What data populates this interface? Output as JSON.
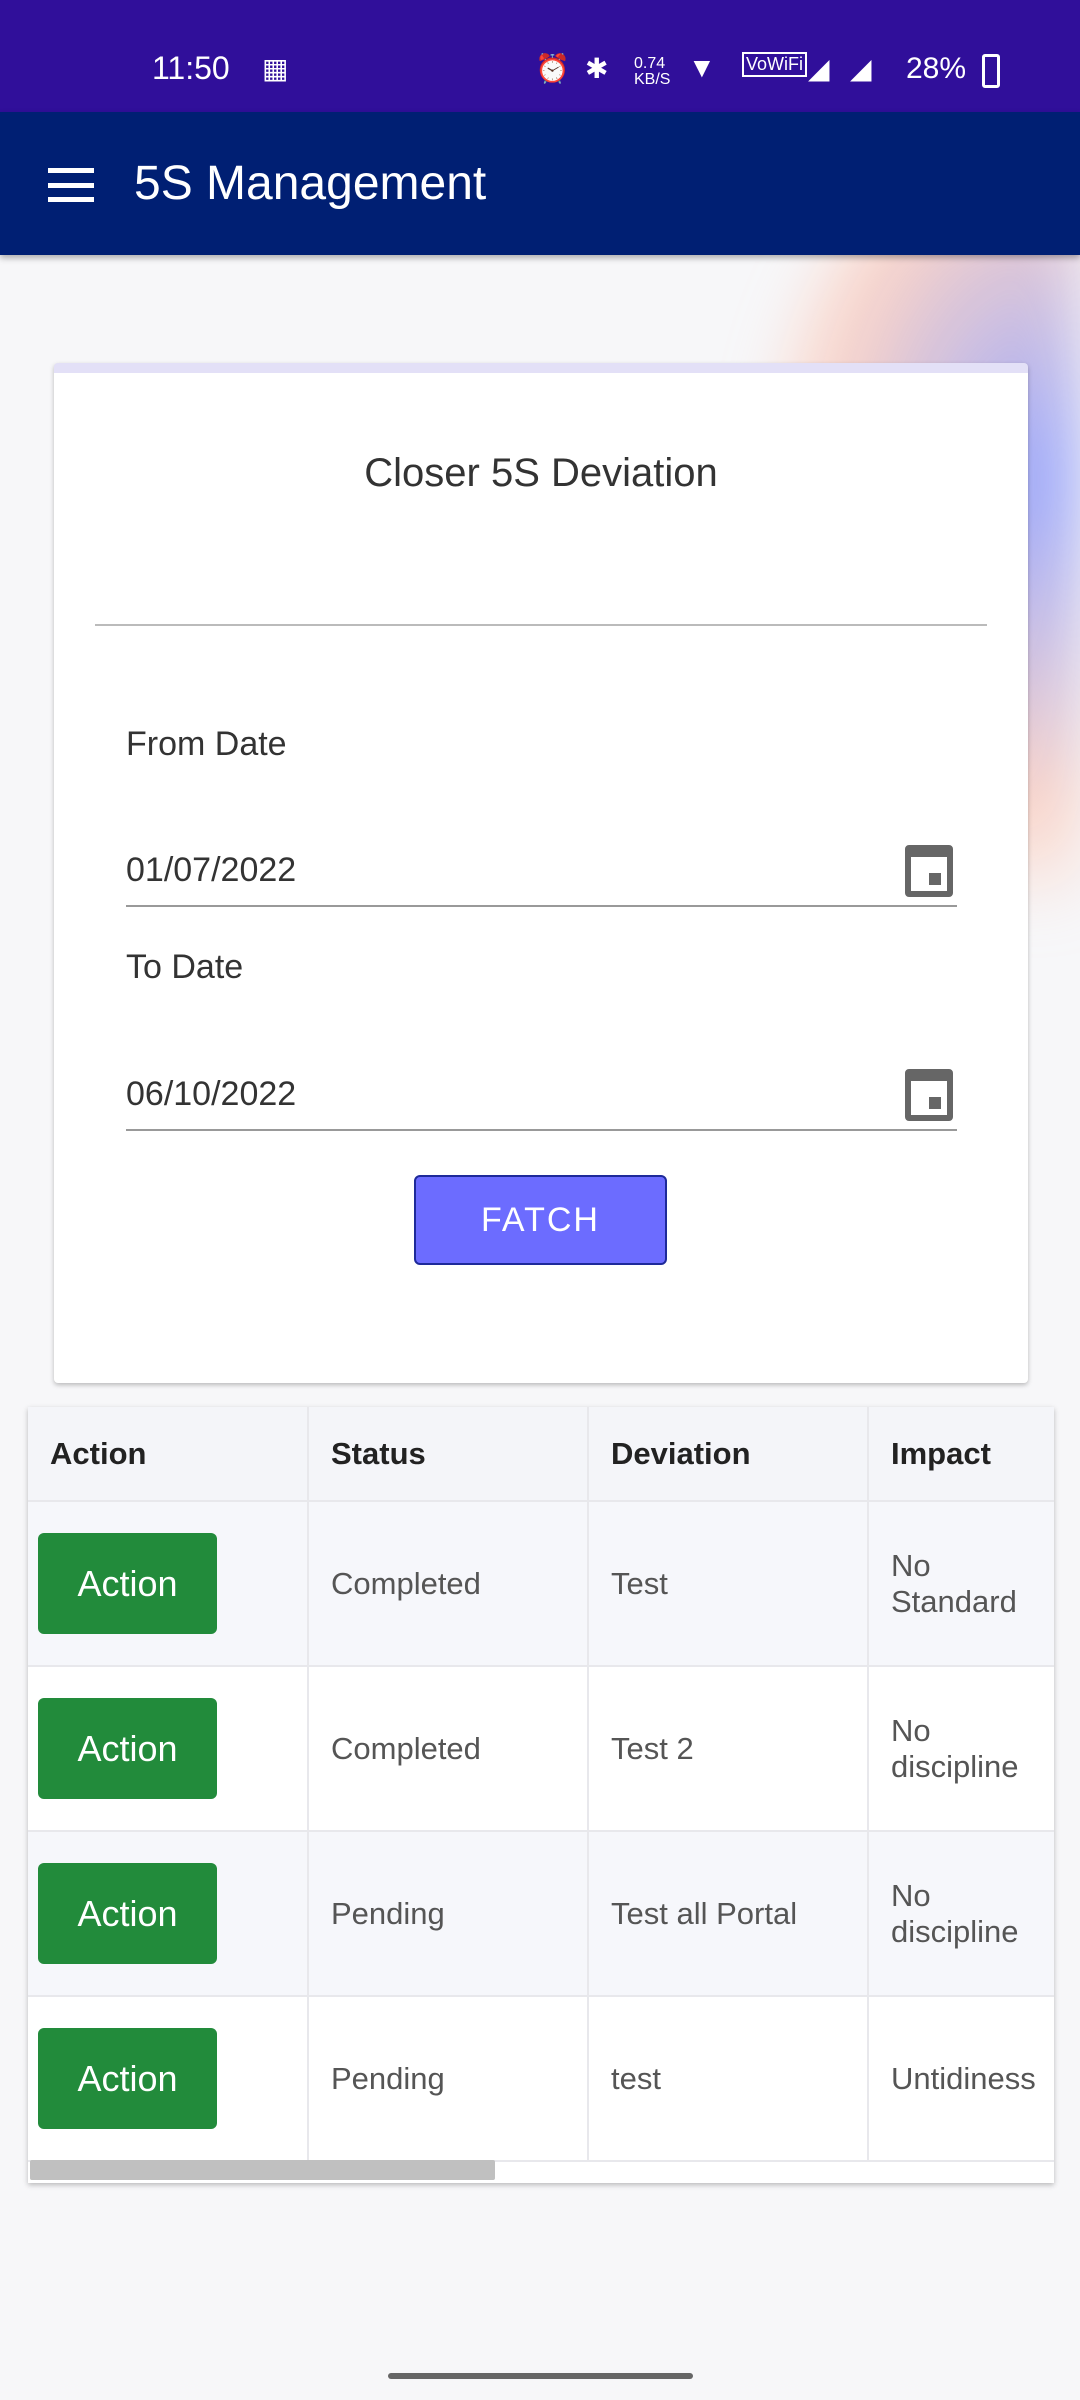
{
  "status_bar": {
    "time": "11:50",
    "net_speed": "0.74 KB/S",
    "battery": "28%",
    "icons": [
      "sim-toolkit-icon",
      "alarm-icon",
      "bluetooth-icon",
      "wifi-icon",
      "vowifi-icon",
      "signal-icon",
      "signal-icon",
      "battery-icon"
    ]
  },
  "app_bar": {
    "title": "5S Management",
    "menu_icon": "hamburger-menu-icon"
  },
  "form": {
    "title": "Closer 5S Deviation",
    "from_label": "From Date",
    "from_value": "01/07/2022",
    "to_label": "To Date",
    "to_value": "06/10/2022",
    "fetch_label": "FATCH"
  },
  "table": {
    "headers": [
      "Action",
      "Status",
      "Deviation",
      "Impact"
    ],
    "rows": [
      {
        "action": "Action",
        "status": "Completed",
        "deviation": "Test",
        "impact": "No Standard"
      },
      {
        "action": "Action",
        "status": "Completed",
        "deviation": "Test 2",
        "impact": "No discipline"
      },
      {
        "action": "Action",
        "status": "Pending",
        "deviation": "Test all Portal",
        "impact": "No discipline"
      },
      {
        "action": "Action",
        "status": "Pending",
        "deviation": "test",
        "impact": "Untidiness"
      }
    ]
  },
  "colors": {
    "status_bar": "#300f9a",
    "app_bar": "#001f73",
    "fetch_button": "#6c6cff",
    "action_button": "#228b3b"
  }
}
